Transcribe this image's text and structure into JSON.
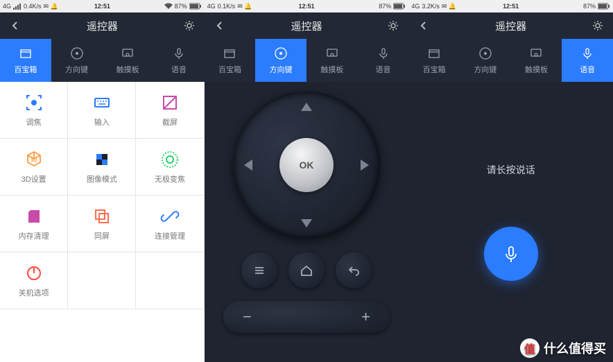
{
  "status": {
    "network_prefix": "4G",
    "speed": [
      "0.4K/s",
      "0.1K/s",
      "3.2K/s"
    ],
    "clock": "12:51",
    "battery": "87%"
  },
  "header": {
    "title": "遥控器"
  },
  "tabs": [
    {
      "label": "百宝箱"
    },
    {
      "label": "方向键"
    },
    {
      "label": "触摸板"
    },
    {
      "label": "语音"
    }
  ],
  "grid": [
    {
      "label": "调焦",
      "color": "#2b7cff",
      "icon": "focus"
    },
    {
      "label": "输入",
      "color": "#2b7cff",
      "icon": "keyboard"
    },
    {
      "label": "截屏",
      "color": "#c94aa8",
      "icon": "crop"
    },
    {
      "label": "3D设置",
      "color": "#ff9a3d",
      "icon": "3d"
    },
    {
      "label": "图像模式",
      "color": "#2b7cff",
      "icon": "pattern"
    },
    {
      "label": "无极变焦",
      "color": "#2dcd6f",
      "icon": "disc"
    },
    {
      "label": "内存清理",
      "color": "#c94aa8",
      "icon": "sdcard"
    },
    {
      "label": "同屏",
      "color": "#ff6e50",
      "icon": "copy"
    },
    {
      "label": "连接管理",
      "color": "#2b7cff",
      "icon": "link"
    },
    {
      "label": "关机选项",
      "color": "#ff4a3d",
      "icon": "power"
    }
  ],
  "dpad": {
    "ok": "OK"
  },
  "voice": {
    "prompt": "请长按说话"
  },
  "watermark": {
    "text": "什么值得买",
    "badge": "值"
  }
}
